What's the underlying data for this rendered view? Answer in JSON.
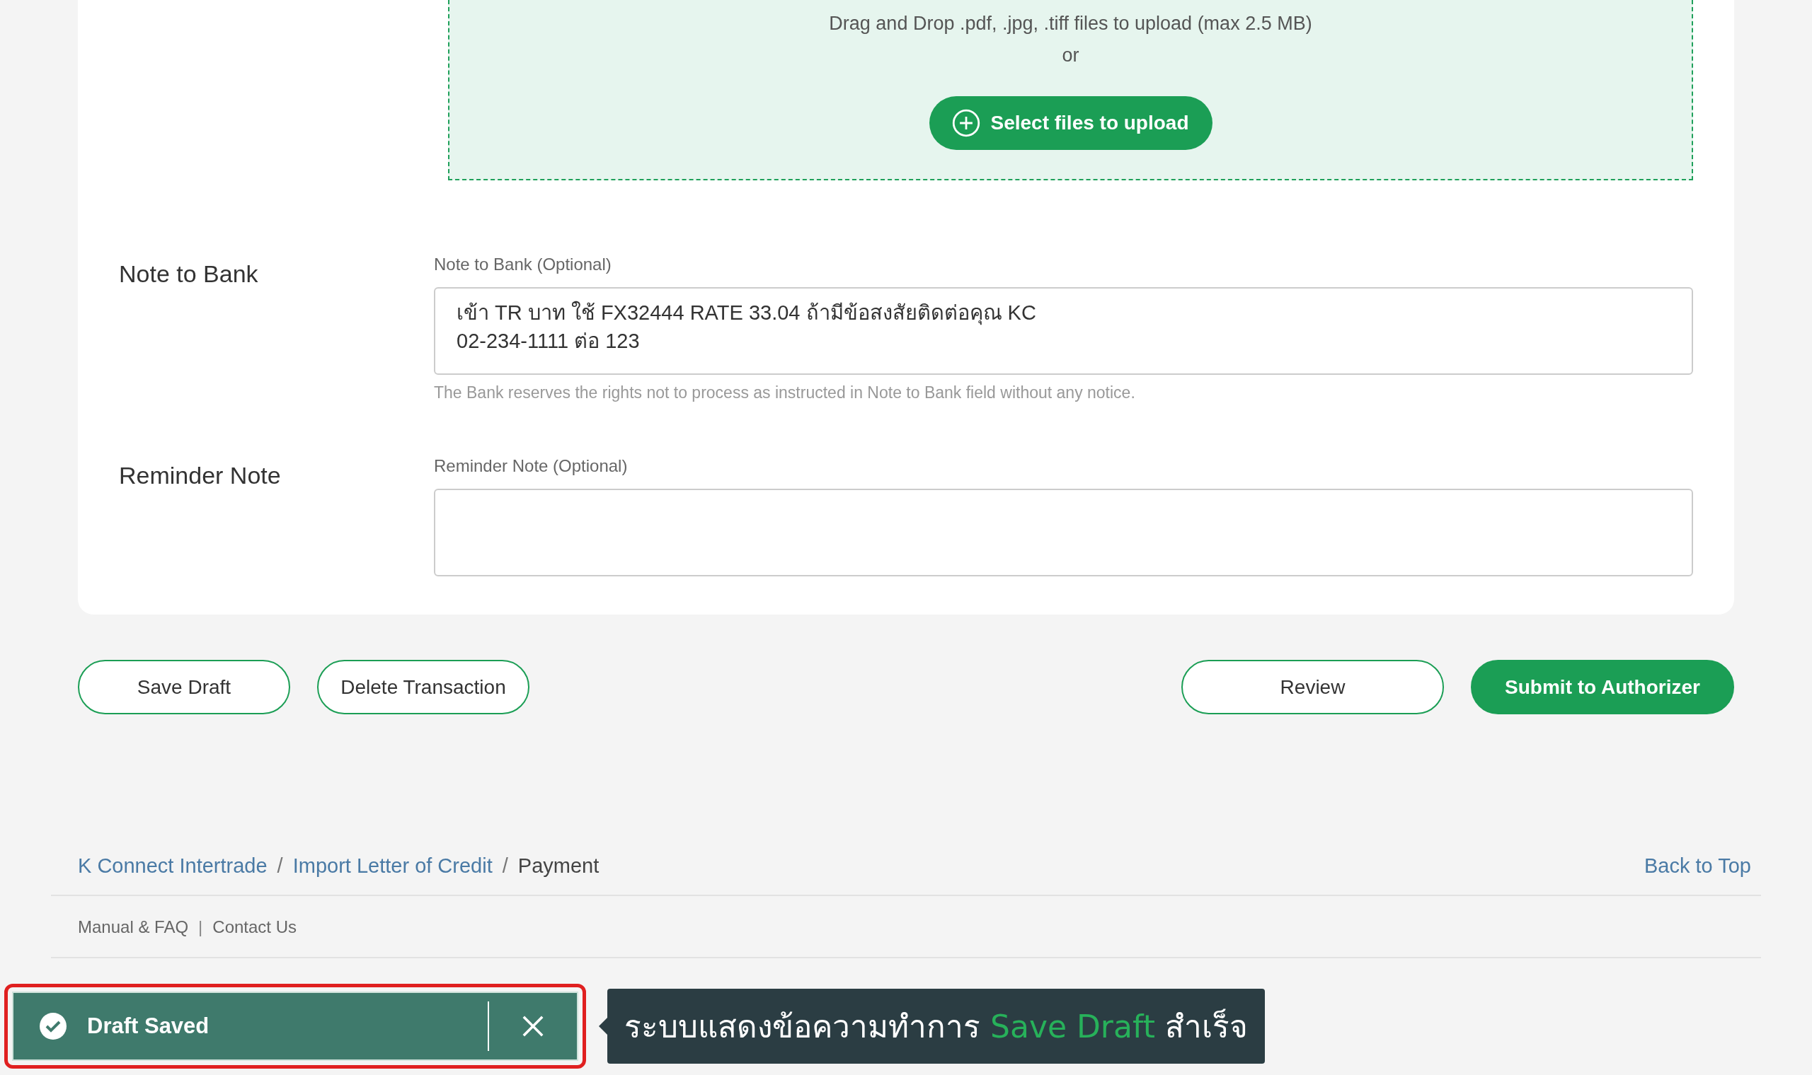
{
  "upload": {
    "hint": "Drag and Drop .pdf, .jpg, .tiff files to upload (max 2.5 MB)",
    "or": "or",
    "button": "Select files to upload"
  },
  "fields": [
    {
      "label": "Note to Bank",
      "field_label": "Note to Bank (Optional)",
      "value": "เข้า TR บาท ใช้ FX32444 RATE 33.04 ถ้ามีข้อสงสัยติดต่อคุณ KC\n02-234-1111 ต่อ 123",
      "help": "The Bank reserves the rights not to process as instructed in Note to Bank field without any notice."
    },
    {
      "label": "Reminder Note",
      "field_label": "Reminder Note (Optional)"
    }
  ],
  "actions": [
    {
      "label": "Save Draft",
      "kind": "outline"
    },
    {
      "label": "Delete Transaction",
      "kind": "outline"
    },
    {
      "label": "Review",
      "kind": "outline"
    },
    {
      "label": "Submit to Authorizer",
      "kind": "primary"
    }
  ],
  "breadcrumb": [
    {
      "label": "K Connect Intertrade",
      "link": true
    },
    {
      "label": "/"
    },
    {
      "label": "Import Letter of Credit",
      "link": true
    },
    {
      "label": "/"
    },
    {
      "label": "Payment",
      "link": false
    }
  ],
  "back_to_top": "Back to Top",
  "footer_links": [
    "Manual & FAQ",
    "|",
    "Contact Us"
  ],
  "toast": {
    "message": "Draft Saved",
    "highlighted": true
  },
  "annotation": {
    "before": "ระบบแสดงข้อความทำการ",
    "highlight": "Save Draft",
    "after": "สำเร็จ"
  }
}
